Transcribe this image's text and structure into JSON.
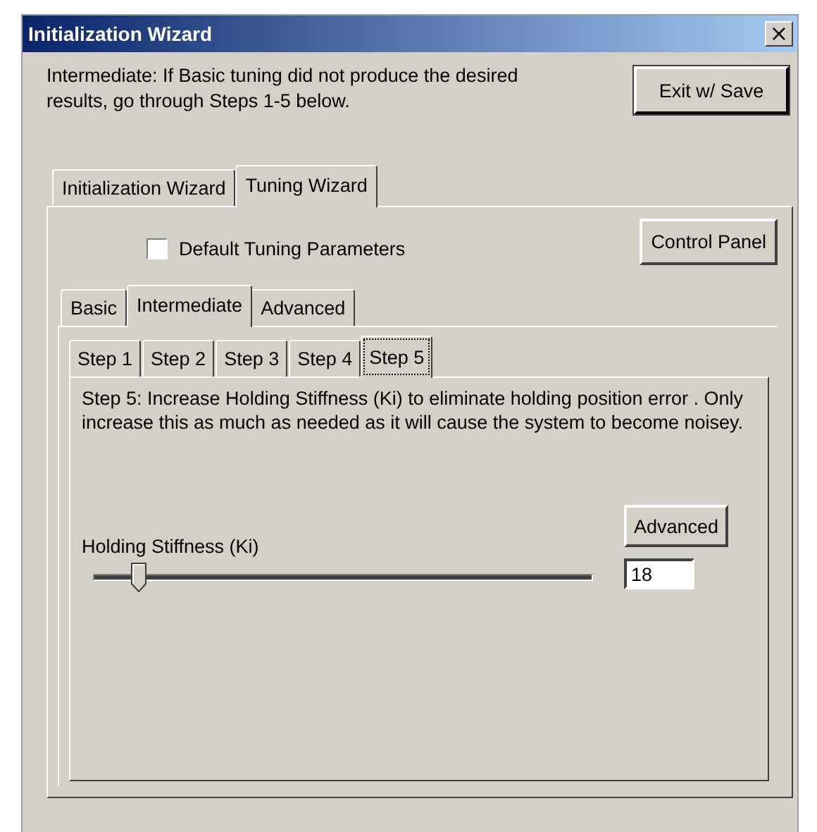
{
  "window": {
    "title": "Initialization Wizard",
    "close": "×"
  },
  "intro": "Intermediate:  If Basic tuning did not produce the desired results, go through Steps 1-5 below.",
  "exit_button": "Exit w/ Save",
  "tabs": [
    {
      "label": "Initialization Wizard",
      "selected": false
    },
    {
      "label": "Tuning Wizard",
      "selected": true
    }
  ],
  "default_tuning": {
    "label": "Default Tuning Parameters",
    "checked": false
  },
  "control_panel_button": "Control Panel",
  "mode_tabs": [
    {
      "label": "Basic",
      "selected": false
    },
    {
      "label": "Intermediate",
      "selected": true
    },
    {
      "label": "Advanced",
      "selected": false
    }
  ],
  "step_tabs": [
    {
      "label": "Step 1",
      "selected": false
    },
    {
      "label": "Step 2",
      "selected": false
    },
    {
      "label": "Step 3",
      "selected": false
    },
    {
      "label": "Step 4",
      "selected": false
    },
    {
      "label": "Step 5",
      "selected": true
    }
  ],
  "step_text": "Step 5:  Increase Holding Stiffness (Ki) to eliminate holding position error .  Only increase this as much as needed as it will cause the system to become noisey.",
  "slider": {
    "label": "Holding Stiffness (Ki)",
    "level": 0.09,
    "value": "18"
  },
  "advanced_button": "Advanced"
}
